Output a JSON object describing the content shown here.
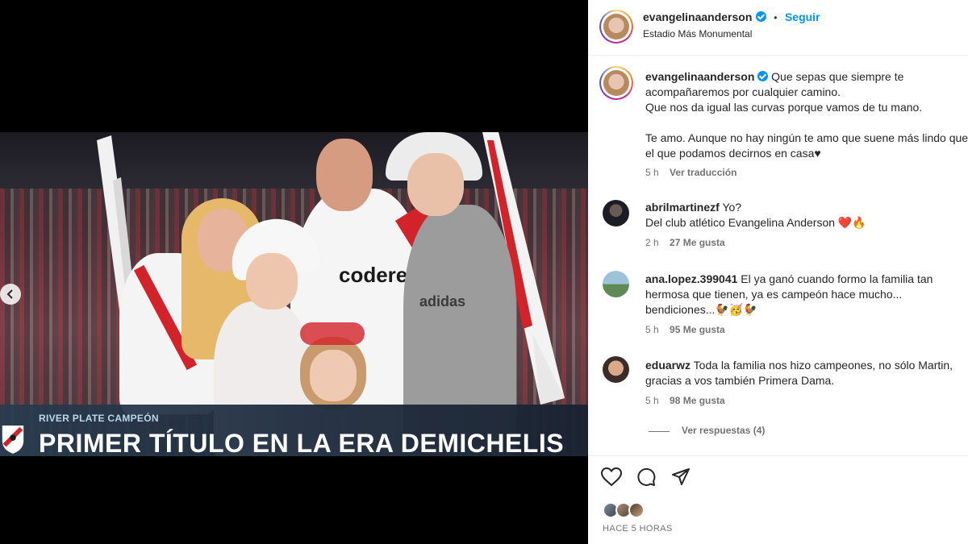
{
  "post": {
    "chyron_kicker": "RIVER PLATE CAMPEÓN",
    "chyron_title": "PRIMER TÍTULO EN LA ERA DEMICHELIS",
    "sponsor_text": "adidas",
    "shirt_sponsor": "codere"
  },
  "header": {
    "username": "evangelinaanderson",
    "separator": "•",
    "follow_label": "Seguir",
    "location": "Estadio Más Monumental"
  },
  "caption": {
    "username": "evangelinaanderson",
    "line1": "Que sepas que siempre te",
    "line2": "acompañaremos por cualquier camino.",
    "line3": "Que nos da igual las curvas porque vamos de tu mano.",
    "line4": "Te amo. Aunque no hay ningún te amo que suene más lindo que",
    "line5": "el que podamos decirnos en casa♥",
    "time": "5 h",
    "translate": "Ver traducción"
  },
  "comments": [
    {
      "username": "abrilmartinezf",
      "line1": "Yo?",
      "line2": "Del club atlético Evangelina Anderson ❤️🔥",
      "time": "2 h",
      "likes": "27 Me gusta"
    },
    {
      "username": "ana.lopez.399041",
      "line1": "El ya ganó cuando formo la familia tan",
      "line2": "hermosa que tienen, ya es campeón hace mucho...",
      "line3": "bendiciones...🐓🥳🐓",
      "time": "5 h",
      "likes": "95 Me gusta"
    },
    {
      "username": "eduarwz",
      "line1": "Toda la familia nos hizo campeones, no sólo Martin,",
      "line2": "gracias a vos también Primera Dama.",
      "time": "5 h",
      "likes": "98 Me gusta",
      "replies": "Ver respuestas (4)"
    }
  ],
  "footer": {
    "time_ago": "HACE 5 HORAS"
  },
  "icons": {
    "like": "heart-icon",
    "comment": "comment-icon",
    "share": "share-icon",
    "prev": "chevron-left-icon",
    "verified": "verified-badge-icon"
  },
  "colors": {
    "accent": "#0095f6",
    "text": "#262626",
    "muted": "#737373",
    "river_red": "#d2232a"
  }
}
